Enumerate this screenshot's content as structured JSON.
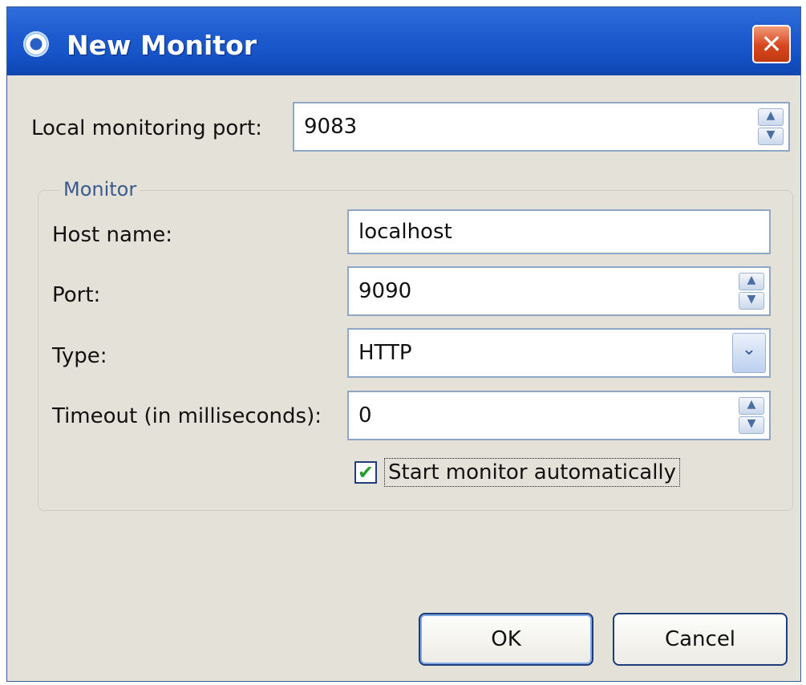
{
  "window": {
    "title": "New Monitor",
    "close_glyph": "✕"
  },
  "local_port": {
    "label": "Local monitoring port:",
    "value": "9083"
  },
  "monitor_group": {
    "title": "Monitor",
    "host": {
      "label": "Host name:",
      "value": "localhost"
    },
    "port": {
      "label": "Port:",
      "value": "9090"
    },
    "type": {
      "label": "Type:",
      "value": "HTTP"
    },
    "timeout": {
      "label": "Timeout (in milliseconds):",
      "value": "0"
    },
    "auto_start": {
      "label": "Start monitor automatically",
      "checked": true
    }
  },
  "buttons": {
    "ok": "OK",
    "cancel": "Cancel"
  },
  "icons": {
    "app": "monitor-app-icon",
    "close": "close-icon",
    "spinner": "spinner-arrows-icon",
    "dropdown": "chevron-down-icon",
    "check": "checkmark-icon"
  },
  "colors": {
    "titlebar": "#1e5bd0",
    "dialog_bg": "#e4e1d8",
    "close_button": "#d8461e",
    "group_title": "#3c5b8c",
    "check": "#23a02b"
  }
}
